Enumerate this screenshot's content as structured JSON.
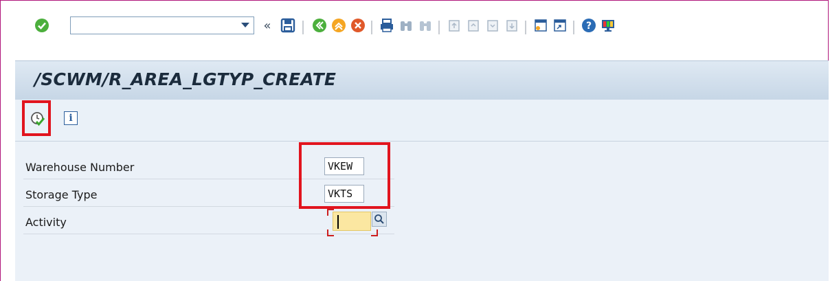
{
  "toolbar": {
    "command_field_value": "",
    "icons": [
      "enter-icon",
      "command-dropdown-icon",
      "collapse-icon",
      "save-icon",
      "back-icon",
      "exit-icon",
      "cancel-icon",
      "print-icon",
      "find-icon",
      "find-next-icon",
      "first-page-icon",
      "previous-page-icon",
      "next-page-icon",
      "last-page-icon",
      "create-session-icon",
      "shortcut-icon",
      "help-icon",
      "customize-layout-icon"
    ]
  },
  "title": "/SCWM/R_AREA_LGTYP_CREATE",
  "app_toolbar": {
    "icons": [
      "execute-icon",
      "info-icon"
    ]
  },
  "form": {
    "rows": [
      {
        "label": "Warehouse Number",
        "value": "VKEW"
      },
      {
        "label": "Storage Type",
        "value": "VKTS"
      },
      {
        "label": "Activity",
        "value": ""
      }
    ]
  },
  "colors": {
    "title_bg": "#c6d6e6",
    "highlight": "#e1141e",
    "required_field": "#fbe7a1"
  }
}
